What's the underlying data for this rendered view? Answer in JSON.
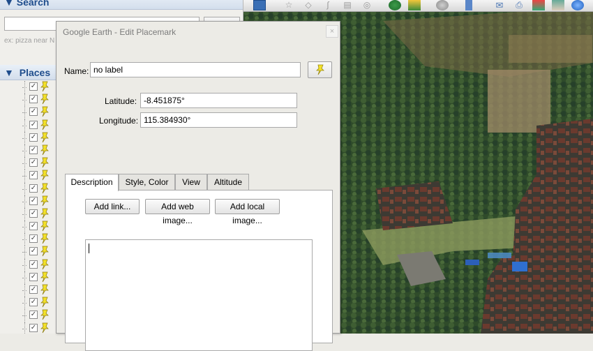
{
  "left_panel": {
    "search_title": "Search",
    "search_hint": "ex: pizza near N",
    "places_title": "Places",
    "place_count": 20
  },
  "dialog": {
    "title": "Google Earth - Edit Placemark",
    "close_label": "×",
    "name_label": "Name:",
    "name_value": "no label",
    "latitude_label": "Latitude:",
    "latitude_value": "-8.451875°",
    "longitude_label": "Longitude:",
    "longitude_value": "115.384930°",
    "tabs": [
      "Description",
      "Style, Color",
      "View",
      "Altitude"
    ],
    "active_tab": "Description",
    "buttons": {
      "add_link": "Add link...",
      "add_web_image": "Add web image...",
      "add_local_image": "Add local image..."
    }
  },
  "colors": {
    "pin_yellow": "#f3e12a",
    "section_header_text": "#1f4d8c"
  },
  "icons": [
    "checkbox-icon",
    "yellow-pushpin-icon",
    "toolbar-icons"
  ]
}
